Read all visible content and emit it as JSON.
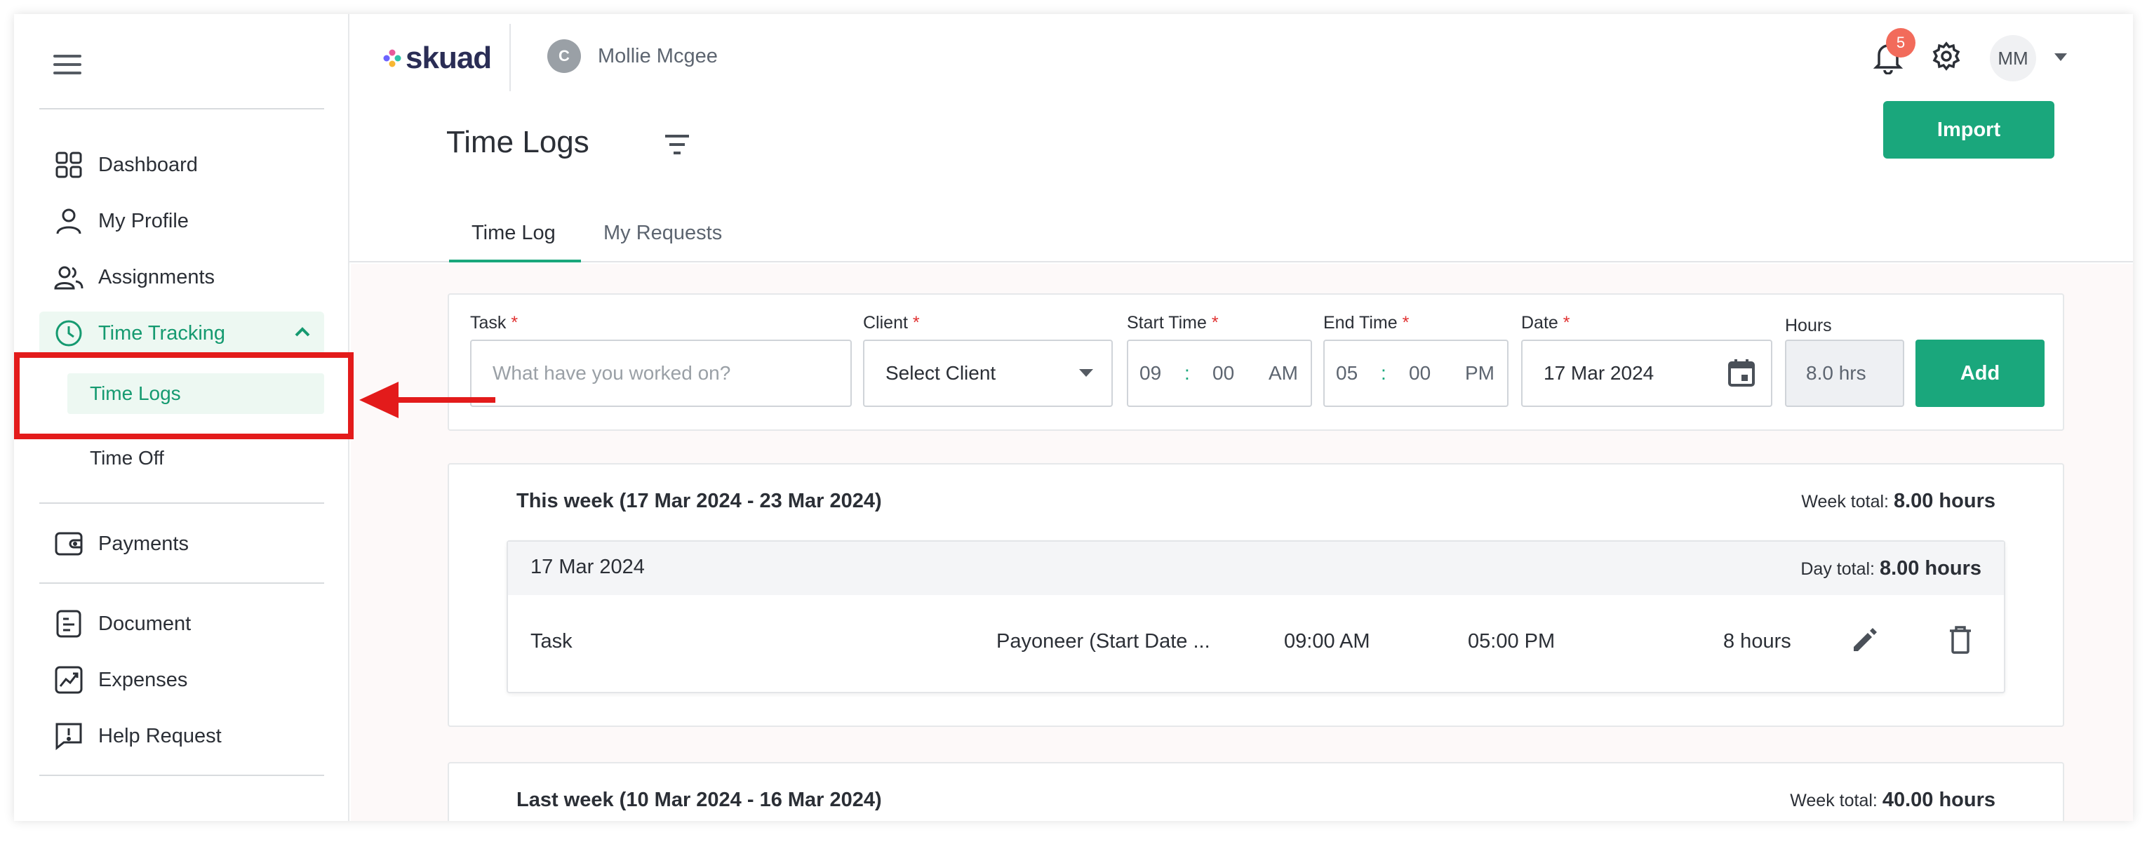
{
  "sidebar": {
    "menu_icon": "hamburger-menu-icon",
    "items": [
      {
        "label": "Dashboard",
        "icon": "grid-icon"
      },
      {
        "label": "My Profile",
        "icon": "person-icon"
      },
      {
        "label": "Assignments",
        "icon": "people-icon"
      },
      {
        "label": "Time Tracking",
        "icon": "clock-icon"
      },
      {
        "label": "Payments",
        "icon": "wallet-icon"
      },
      {
        "label": "Document",
        "icon": "document-icon"
      },
      {
        "label": "Expenses",
        "icon": "chart-icon"
      },
      {
        "label": "Help Request",
        "icon": "help-chat-icon"
      }
    ],
    "sub_items": [
      {
        "label": "Time Logs"
      },
      {
        "label": "Time Off"
      }
    ]
  },
  "header": {
    "logo_text": "skuad",
    "client_initial": "C",
    "client_name": "Mollie Mcgee",
    "notification_count": "5",
    "user_initials": "MM"
  },
  "page": {
    "title": "Time Logs",
    "import_label": "Import",
    "tabs": [
      {
        "label": "Time Log"
      },
      {
        "label": "My Requests"
      }
    ]
  },
  "form": {
    "task_label": "Task",
    "task_placeholder": "What have you worked on?",
    "client_label": "Client",
    "client_value": "Select Client",
    "start_label": "Start Time",
    "start_hour": "09",
    "start_min": "00",
    "start_ampm": "AM",
    "end_label": "End Time",
    "end_hour": "05",
    "end_min": "00",
    "end_ampm": "PM",
    "date_label": "Date",
    "date_value": "17 Mar 2024",
    "hours_label": "Hours",
    "hours_value": "8.0 hrs",
    "add_label": "Add",
    "required_mark": "*",
    "colon": ":"
  },
  "weeks": [
    {
      "title": "This week (17 Mar 2024 - 23 Mar 2024)",
      "total_label": "Week total:",
      "total_value": "8.00 hours",
      "day": {
        "date": "17 Mar 2024",
        "total_label": "Day total:",
        "total_value": "8.00 hours",
        "entry": {
          "task": "Task",
          "client": "Payoneer (Start Date ...",
          "start": "09:00 AM",
          "end": "05:00 PM",
          "hours": "8 hours"
        }
      }
    },
    {
      "title": "Last week (10 Mar 2024 - 16 Mar 2024)",
      "total_label": "Week total:",
      "total_value": "40.00 hours"
    }
  ],
  "colors": {
    "accent": "#1aa77c",
    "highlight": "#e31b1b",
    "badge": "#f26b5b"
  }
}
